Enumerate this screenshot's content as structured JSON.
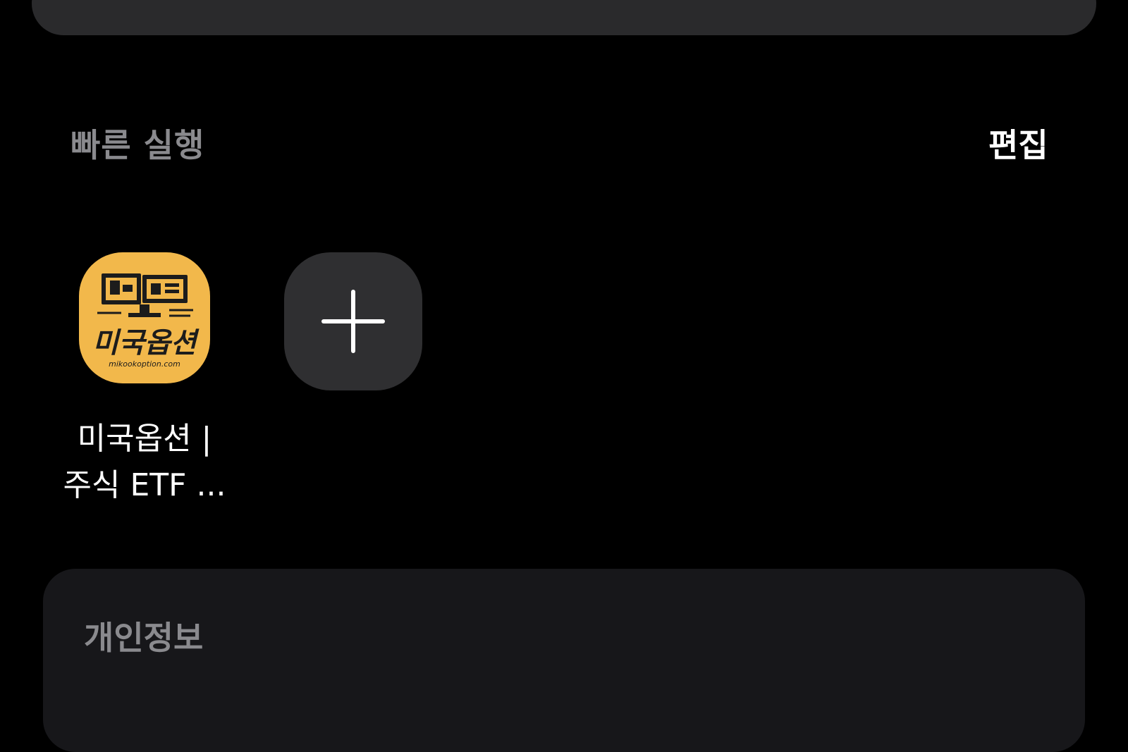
{
  "search_bar": {
    "avatar_icon": "avatar-icon"
  },
  "quick_launch": {
    "title": "빠른 실행",
    "edit_label": "편집",
    "apps": [
      {
        "label": "미국옵션 |\n주식 ETF ...",
        "icon_text": "미국옵션",
        "icon_subtext": "mikookoption.com",
        "icon_name": "mikookoption-app-icon",
        "icon_color": "#f2b84b"
      }
    ],
    "add_icon": "plus-icon"
  },
  "privacy": {
    "title": "개인정보"
  }
}
